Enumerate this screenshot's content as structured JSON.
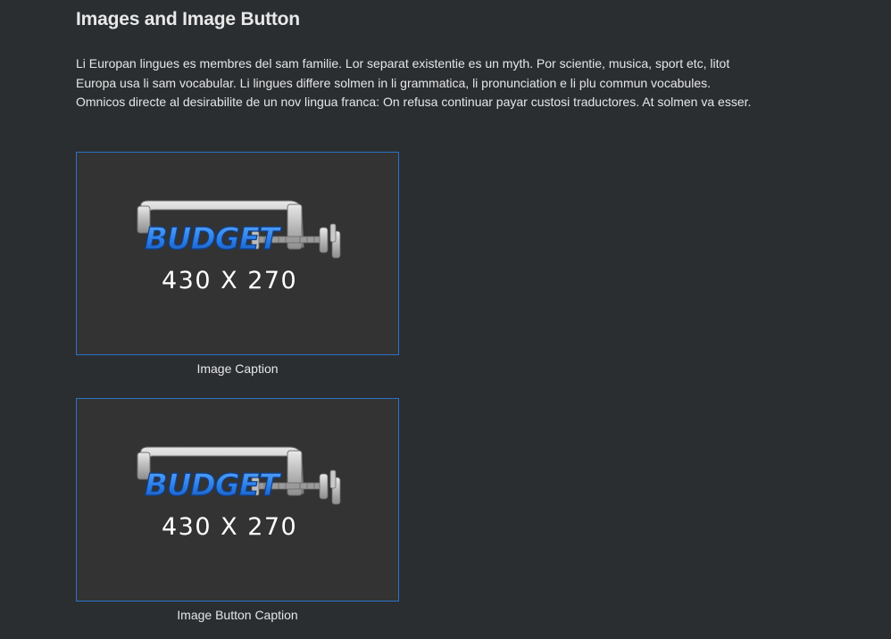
{
  "section": {
    "title": "Images and Image Button",
    "paragraph": "Li Europan lingues es membres del sam familie. Lor separat existentie es un myth. Por scientie, musica, sport etc, litot Europa usa li sam vocabular. Li lingues differe solmen in li grammatica, li pronunciation e li plu commun vocabules. Omnicos directe al desirabilite de un nov lingua franca: On refusa continuar payar custosi traductores. At solmen va esser."
  },
  "image": {
    "logo_text": "BUDGET",
    "dimensions_text": "430 X 270",
    "caption": "Image Caption"
  },
  "image_button": {
    "logo_text": "BUDGET",
    "dimensions_text": "430 X 270",
    "caption": "Image Button Caption"
  },
  "colors": {
    "background": "#2b2e31",
    "frame_border": "#2a73c9",
    "frame_fill": "#333333",
    "logo_blue": "#2f7fe6"
  }
}
